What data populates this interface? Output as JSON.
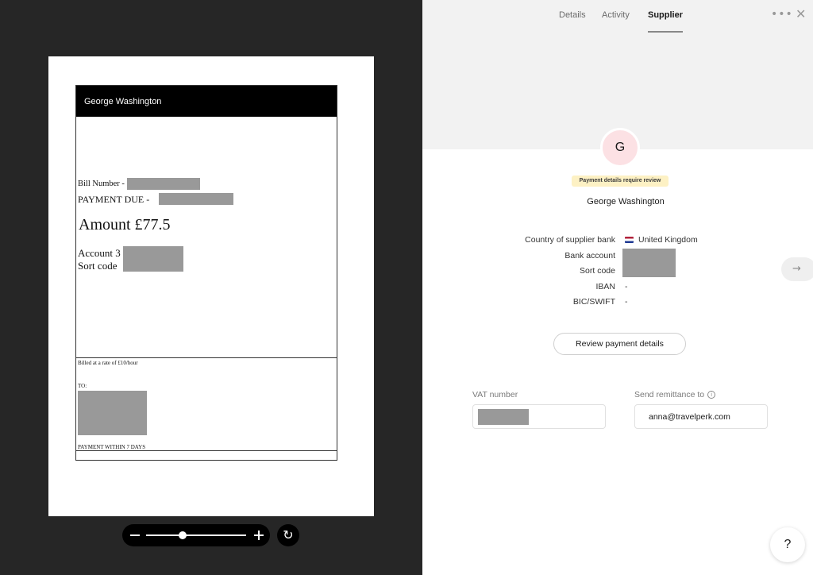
{
  "document": {
    "header_name": "George Washington",
    "bill_number_label": "Bill Number -",
    "payment_due_label": "PAYMENT DUE  -",
    "amount": "Amount £77.5",
    "account_label": "Account 3",
    "sort_code_label": "Sort code",
    "rate_note": "Billed at a rate of £10/hour",
    "to_label": "TO:",
    "payment_terms": "PAYMENT WITHIN 7 DAYS"
  },
  "zoom": {
    "level": 0.35,
    "minus_icon": "minus-icon",
    "plus_icon": "plus-icon",
    "rotate_icon": "rotate-icon",
    "rotate_glyph": "↻"
  },
  "tabs": [
    {
      "label": "Details"
    },
    {
      "label": "Activity"
    },
    {
      "label": "Supplier",
      "active": true
    }
  ],
  "header_icons": {
    "more": "•••",
    "close": "✕"
  },
  "supplier": {
    "avatar_initial": "G",
    "review_badge": "Payment details require review",
    "name": "George Washington",
    "fields": {
      "country_label": "Country of supplier bank",
      "country_value": "United Kingdom",
      "bank_account_label": "Bank account",
      "sort_code_label": "Sort code",
      "iban_label": "IBAN",
      "iban_value": "-",
      "bic_label": "BIC/SWIFT",
      "bic_value": "-"
    },
    "review_button": "Review payment details",
    "vat_label": "VAT number",
    "remittance_label": "Send remittance to",
    "remittance_value": "anna@travelperk.com"
  },
  "nav": {
    "next_glyph": "→",
    "help_label": "?"
  },
  "colors": {
    "avatar_bg": "#fce1e4",
    "badge_bg": "#fdf1c4",
    "viewer_bg": "#262626"
  }
}
